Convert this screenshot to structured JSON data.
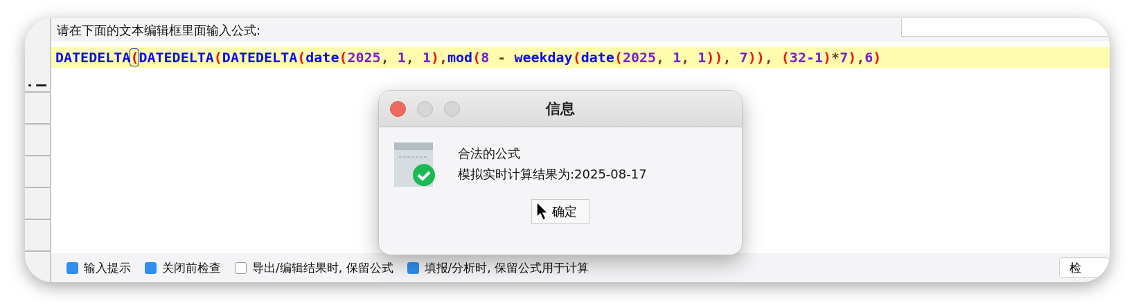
{
  "prompt": "请在下面的文本编辑框里面输入公式:",
  "formula": [
    {
      "kind": "func",
      "text": "DATEDELTA",
      "boxed": false
    },
    {
      "kind": "paren",
      "text": "(",
      "boxed": true
    },
    {
      "kind": "func",
      "text": "DATEDELTA",
      "boxed": false
    },
    {
      "kind": "paren",
      "text": "(",
      "boxed": false
    },
    {
      "kind": "func",
      "text": "DATEDELTA",
      "boxed": false
    },
    {
      "kind": "paren",
      "text": "(",
      "boxed": false
    },
    {
      "kind": "func",
      "text": "date",
      "boxed": false
    },
    {
      "kind": "paren",
      "text": "(",
      "boxed": false
    },
    {
      "kind": "number",
      "text": "2025",
      "boxed": false
    },
    {
      "kind": "op",
      "text": ", ",
      "boxed": false
    },
    {
      "kind": "number",
      "text": "1",
      "boxed": false
    },
    {
      "kind": "op",
      "text": ", ",
      "boxed": false
    },
    {
      "kind": "number",
      "text": "1",
      "boxed": false
    },
    {
      "kind": "paren",
      "text": ")",
      "boxed": false
    },
    {
      "kind": "op",
      "text": ",",
      "boxed": false
    },
    {
      "kind": "func",
      "text": "mod",
      "boxed": false
    },
    {
      "kind": "paren",
      "text": "(",
      "boxed": false
    },
    {
      "kind": "number",
      "text": "8",
      "boxed": false
    },
    {
      "kind": "op",
      "text": " - ",
      "boxed": false
    },
    {
      "kind": "func",
      "text": "weekday",
      "boxed": false
    },
    {
      "kind": "paren",
      "text": "(",
      "boxed": false
    },
    {
      "kind": "func",
      "text": "date",
      "boxed": false
    },
    {
      "kind": "paren",
      "text": "(",
      "boxed": false
    },
    {
      "kind": "number",
      "text": "2025",
      "boxed": false
    },
    {
      "kind": "op",
      "text": ", ",
      "boxed": false
    },
    {
      "kind": "number",
      "text": "1",
      "boxed": false
    },
    {
      "kind": "op",
      "text": ", ",
      "boxed": false
    },
    {
      "kind": "number",
      "text": "1",
      "boxed": false
    },
    {
      "kind": "paren",
      "text": "))",
      "boxed": false
    },
    {
      "kind": "op",
      "text": ", ",
      "boxed": false
    },
    {
      "kind": "number",
      "text": "7",
      "boxed": false
    },
    {
      "kind": "paren",
      "text": "))",
      "boxed": false
    },
    {
      "kind": "op",
      "text": ", ",
      "boxed": false
    },
    {
      "kind": "paren",
      "text": "(",
      "boxed": false
    },
    {
      "kind": "number",
      "text": "32-1",
      "boxed": false
    },
    {
      "kind": "paren",
      "text": ")",
      "boxed": false
    },
    {
      "kind": "op",
      "text": "*",
      "boxed": false
    },
    {
      "kind": "number",
      "text": "7",
      "boxed": false
    },
    {
      "kind": "paren",
      "text": ")",
      "boxed": false
    },
    {
      "kind": "op",
      "text": ",",
      "boxed": false
    },
    {
      "kind": "number",
      "text": "6",
      "boxed": false
    },
    {
      "kind": "paren",
      "text": ")",
      "boxed": false
    }
  ],
  "dialog": {
    "title": "信息",
    "message": "合法的公式",
    "result": "模拟实时计算结果为:2025-08-17",
    "ok_button": "确定"
  },
  "options": [
    {
      "label": "输入提示",
      "checked": true
    },
    {
      "label": "关闭前检查",
      "checked": true
    },
    {
      "label": "导出/编辑结果时, 保留公式",
      "checked": false
    },
    {
      "label": "填报/分析时, 保留公式用于计算",
      "checked": true
    }
  ],
  "check_button": "检"
}
